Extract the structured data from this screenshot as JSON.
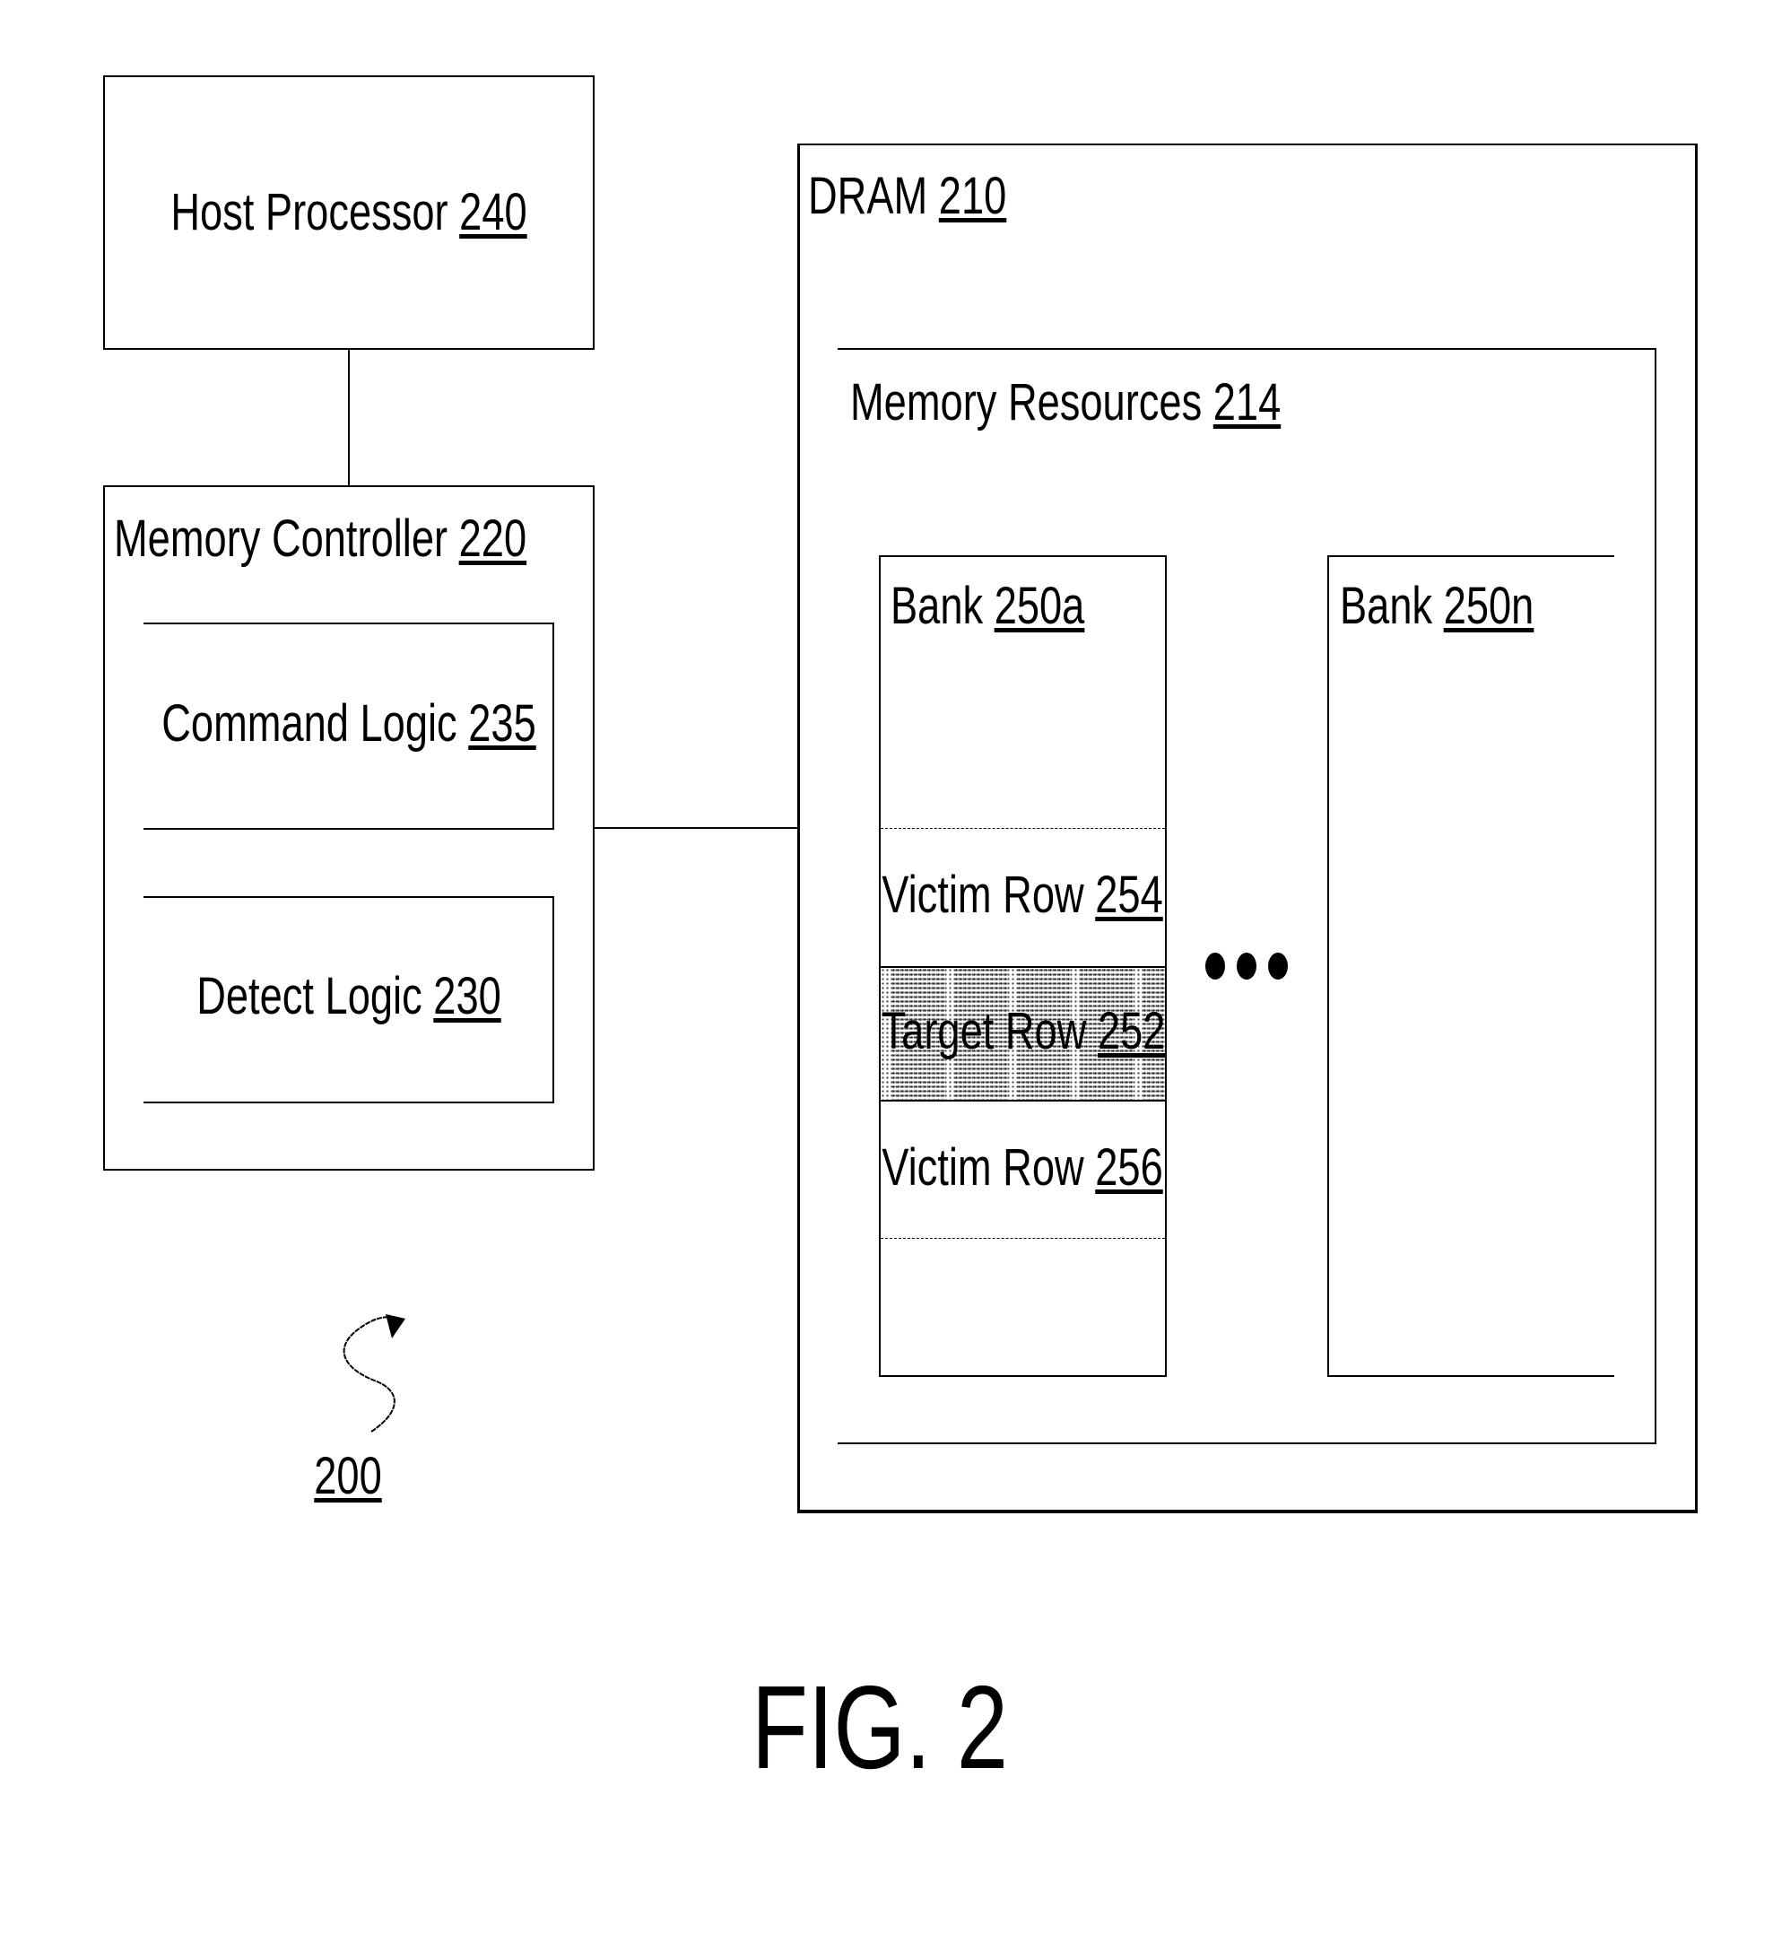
{
  "figure": {
    "caption": "FIG. 2",
    "reference": "200"
  },
  "host_processor": {
    "name": "Host Processor",
    "ref": "240"
  },
  "memory_controller": {
    "name": "Memory Controller",
    "ref": "220",
    "command_logic": {
      "name": "Command Logic",
      "ref": "235"
    },
    "detect_logic": {
      "name": "Detect Logic",
      "ref": "230"
    }
  },
  "dram": {
    "name": "DRAM",
    "ref": "210",
    "memory_resources": {
      "name": "Memory Resources",
      "ref": "214",
      "banks": [
        {
          "name": "Bank",
          "ref": "250a",
          "rows": [
            {
              "name": "Victim Row",
              "ref": "254",
              "type": "victim"
            },
            {
              "name": "Target Row",
              "ref": "252",
              "type": "target"
            },
            {
              "name": "Victim Row",
              "ref": "256",
              "type": "victim"
            }
          ]
        },
        {
          "name": "Bank",
          "ref": "250n"
        }
      ],
      "ellipsis": "•••"
    }
  }
}
